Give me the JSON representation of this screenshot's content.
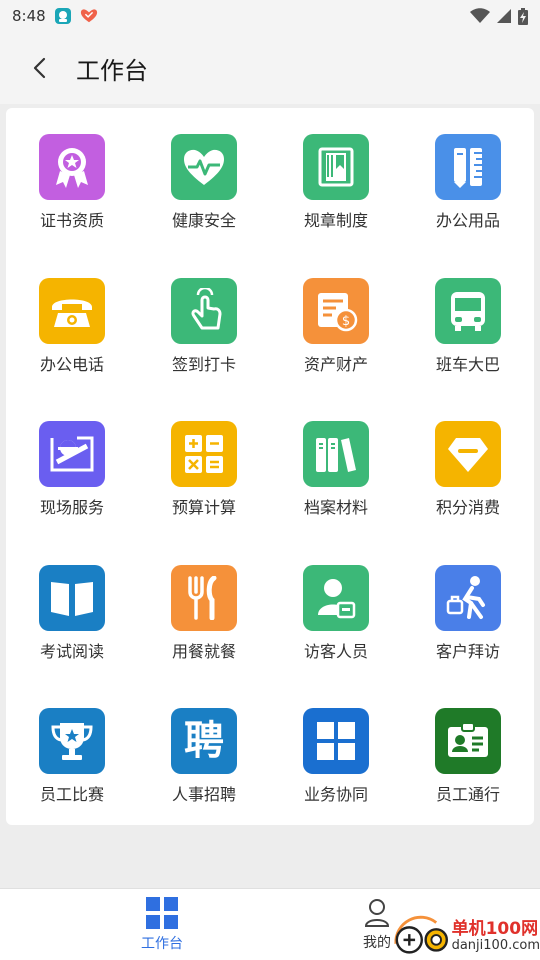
{
  "status_bar": {
    "time": "8:48"
  },
  "header": {
    "title": "工作台"
  },
  "tiles": [
    {
      "label": "证书资质",
      "icon": "certificate-icon",
      "color": "#c25fe0"
    },
    {
      "label": "健康安全",
      "icon": "heart-pulse-icon",
      "color": "#3cb878"
    },
    {
      "label": "规章制度",
      "icon": "rule-book-icon",
      "color": "#3cb878"
    },
    {
      "label": "办公用品",
      "icon": "stationery-icon",
      "color": "#4a90e8"
    },
    {
      "label": "办公电话",
      "icon": "telephone-icon",
      "color": "#f5b400"
    },
    {
      "label": "签到打卡",
      "icon": "touch-icon",
      "color": "#3cb878"
    },
    {
      "label": "资产财产",
      "icon": "asset-bill-icon",
      "color": "#f5913a"
    },
    {
      "label": "班车大巴",
      "icon": "bus-icon",
      "color": "#3cb878"
    },
    {
      "label": "现场服务",
      "icon": "worker-icon",
      "color": "#6a5ef0"
    },
    {
      "label": "预算计算",
      "icon": "calculator-icon",
      "color": "#f5b400"
    },
    {
      "label": "档案材料",
      "icon": "files-icon",
      "color": "#3cb878"
    },
    {
      "label": "积分消费",
      "icon": "diamond-icon",
      "color": "#f5b400"
    },
    {
      "label": "考试阅读",
      "icon": "open-book-icon",
      "color": "#1a7fc4"
    },
    {
      "label": "用餐就餐",
      "icon": "cutlery-icon",
      "color": "#f5913a"
    },
    {
      "label": "访客人员",
      "icon": "visitor-icon",
      "color": "#3cb878"
    },
    {
      "label": "客户拜访",
      "icon": "walking-person-icon",
      "color": "#4a7fe8"
    },
    {
      "label": "员工比赛",
      "icon": "trophy-icon",
      "color": "#1a7fc4"
    },
    {
      "label": "人事招聘",
      "icon": "recruit-icon",
      "color": "#1a7fc4",
      "glyph": "聘"
    },
    {
      "label": "业务协同",
      "icon": "grid-squares-icon",
      "color": "#1a6fd0"
    },
    {
      "label": "员工通行",
      "icon": "id-card-icon",
      "color": "#1f7a28"
    }
  ],
  "bottom_nav": {
    "workbench_label": "工作台",
    "mine_label": "我的"
  },
  "watermark": {
    "brand": "单机100网",
    "url": "danji100.com"
  },
  "colors": {
    "accent": "#2f6fe0"
  }
}
